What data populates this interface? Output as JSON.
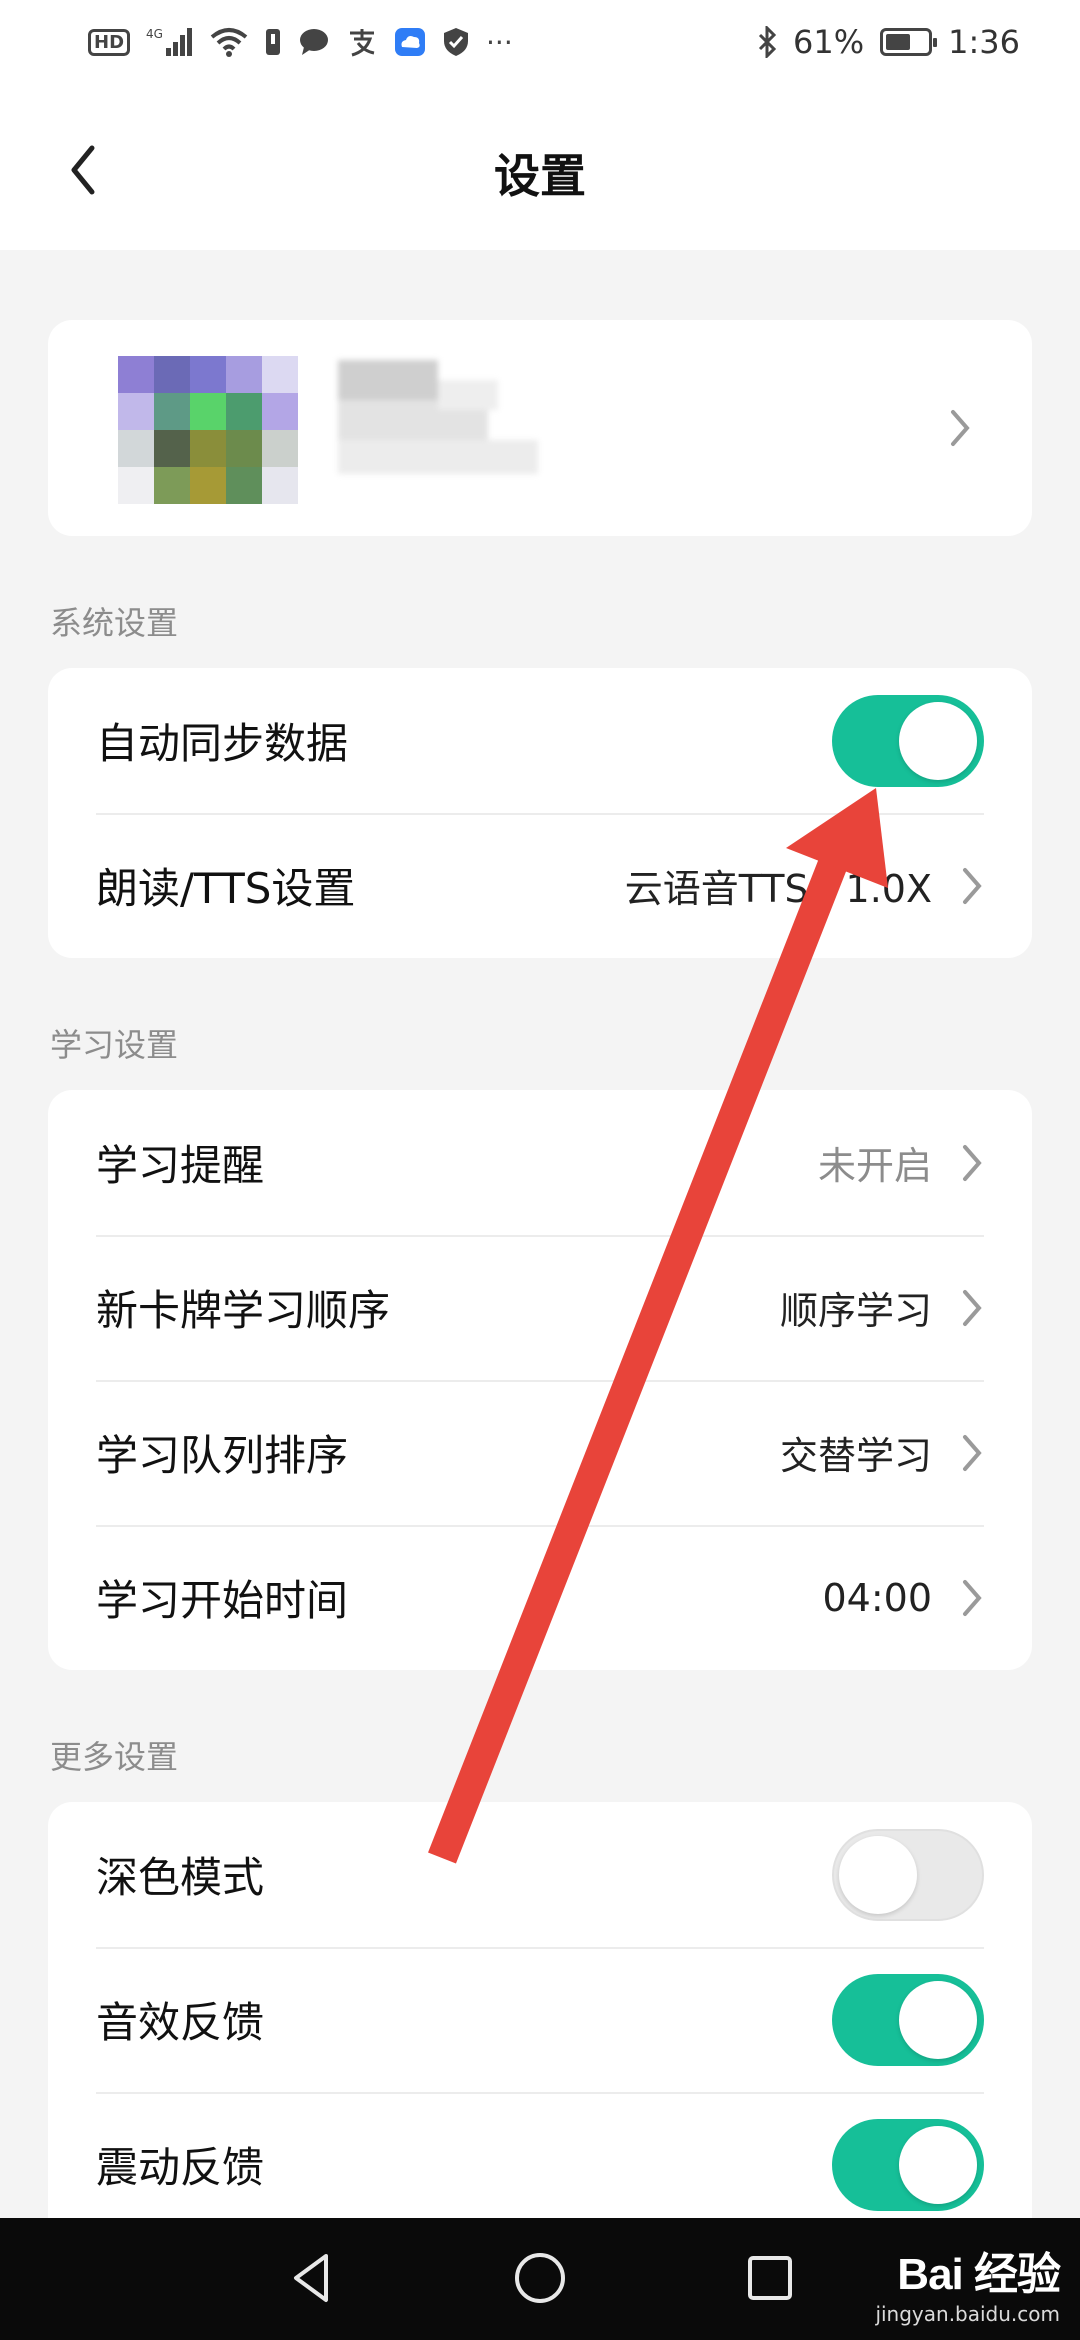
{
  "status_bar": {
    "left_icons": [
      "hd-icon",
      "signal-4g-icon",
      "wifi-icon",
      "sim-icon",
      "chat-icon",
      "alipay-icon",
      "cloud-icon",
      "shield-icon",
      "more-icon"
    ],
    "hd_label": "HD",
    "signal_label": "4G",
    "more_label": "···",
    "battery_percent": "61%",
    "battery_level": 0.61,
    "time": "1:36"
  },
  "header": {
    "title": "设置"
  },
  "sections": {
    "system": {
      "label": "系统设置",
      "auto_sync": {
        "label": "自动同步数据",
        "enabled": true
      },
      "tts": {
        "label": "朗读/TTS设置",
        "value": "云语音TTS / 1.0X"
      }
    },
    "study": {
      "label": "学习设置",
      "reminder": {
        "label": "学习提醒",
        "value": "未开启"
      },
      "new_card_order": {
        "label": "新卡牌学习顺序",
        "value": "顺序学习"
      },
      "queue_sort": {
        "label": "学习队列排序",
        "value": "交替学习"
      },
      "start_time": {
        "label": "学习开始时间",
        "value": "04:00"
      }
    },
    "more": {
      "label": "更多设置",
      "dark_mode": {
        "label": "深色模式",
        "enabled": false
      },
      "sound_feedback": {
        "label": "音效反馈",
        "enabled": true
      },
      "vibration_feedback": {
        "label": "震动反馈",
        "enabled": true
      }
    }
  },
  "watermark": {
    "main": "Bai 经验",
    "sub": "jingyan.baidu.com"
  },
  "colors": {
    "accent": "#16bf98",
    "annotation_arrow": "#e8443a",
    "background": "#f4f4f4"
  }
}
